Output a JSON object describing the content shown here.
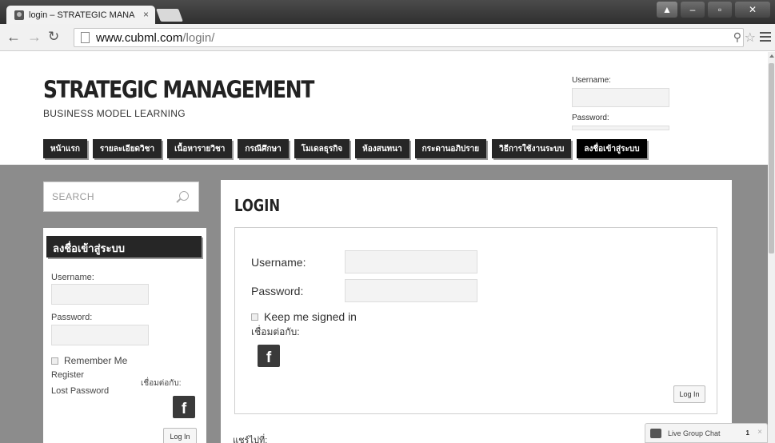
{
  "browser": {
    "tab_title": "login – STRATEGIC MANA",
    "tab_close": "×",
    "url_host": "www.cubml.com",
    "url_path": "/login/"
  },
  "header": {
    "site_title": "STRATEGIC MANAGEMENT",
    "tagline": "BUSINESS MODEL LEARNING",
    "username_label": "Username:",
    "password_label": "Password:"
  },
  "nav": {
    "items": [
      {
        "label": "หน้าแรก"
      },
      {
        "label": "รายละเอียดวิชา"
      },
      {
        "label": "เนื้อหารายวิชา"
      },
      {
        "label": "กรณีศึกษา"
      },
      {
        "label": "โมเดลธุรกิจ"
      },
      {
        "label": "ห้องสนทนา"
      },
      {
        "label": "กระดานอภิปราย"
      },
      {
        "label": "วิธีการใช้งานระบบ"
      },
      {
        "label": "ลงชื่อเข้าสู่ระบบ"
      }
    ]
  },
  "sidebar": {
    "search_placeholder": "SEARCH",
    "widget_title": "ลงชื่อเข้าสู่ระบบ",
    "username_label": "Username:",
    "password_label": "Password:",
    "remember_label": "Remember Me",
    "register_link": "Register",
    "lost_password_link": "Lost Password",
    "connect_label": "เชื่อมต่อกับ:",
    "login_button": "Log In"
  },
  "main": {
    "title": "LOGIN",
    "username_label": "Username:",
    "password_label": "Password:",
    "keep_signed_label": "Keep me signed in",
    "connect_label": "เชื่อมต่อกับ:",
    "login_button": "Log In",
    "share_label": "แชร์ไปที่:"
  },
  "chat": {
    "label": "Live Group Chat",
    "count": "1",
    "close": "×"
  }
}
